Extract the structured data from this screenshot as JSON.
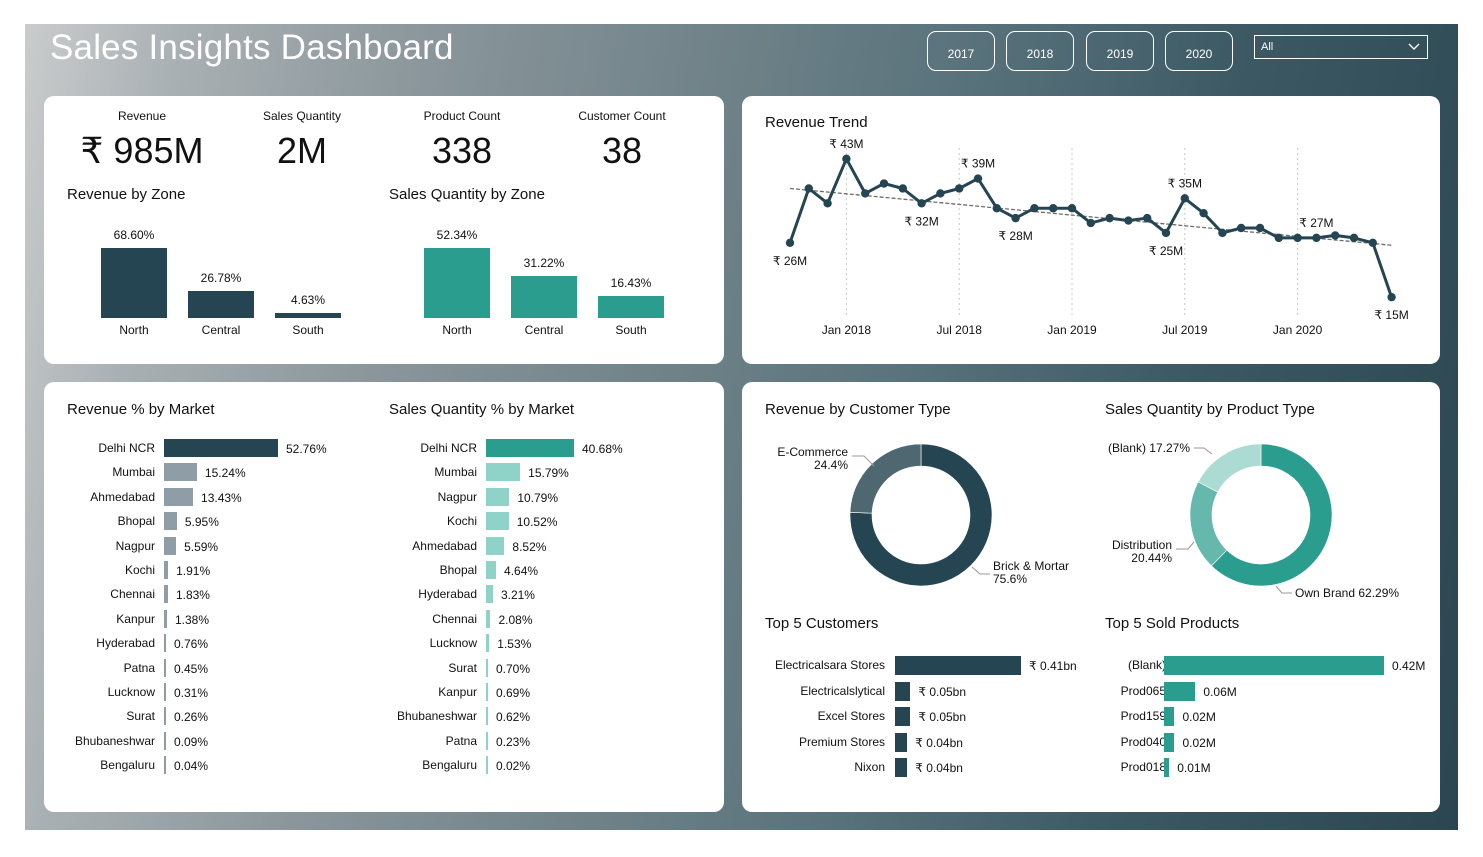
{
  "header": {
    "title": "Sales Insights Dashboard",
    "years": [
      "2017",
      "2018",
      "2019",
      "2020"
    ],
    "dropdown_value": "All"
  },
  "colors": {
    "navy": "#254552",
    "teal": "#2a9d8f",
    "gray_bar": "#8f9ea6",
    "light_teal": "#8fd3c8"
  },
  "kpis": [
    {
      "label": "Revenue",
      "value": "₹ 985M"
    },
    {
      "label": "Sales Quantity",
      "value": "2M"
    },
    {
      "label": "Product Count",
      "value": "338"
    },
    {
      "label": "Customer Count",
      "value": "38"
    }
  ],
  "revenue_by_zone": {
    "title": "Revenue by Zone",
    "items": [
      {
        "zone": "North",
        "pct": 68.6,
        "label": "68.60%"
      },
      {
        "zone": "Central",
        "pct": 26.78,
        "label": "26.78%"
      },
      {
        "zone": "South",
        "pct": 4.63,
        "label": "4.63%"
      }
    ]
  },
  "qty_by_zone": {
    "title": "Sales Quantity by Zone",
    "items": [
      {
        "zone": "North",
        "pct": 52.34,
        "label": "52.34%"
      },
      {
        "zone": "Central",
        "pct": 31.22,
        "label": "31.22%"
      },
      {
        "zone": "South",
        "pct": 16.43,
        "label": "16.43%"
      }
    ]
  },
  "revenue_trend": {
    "title": "Revenue Trend",
    "x_ticks": [
      "Jan 2018",
      "Jul 2018",
      "Jan 2019",
      "Jul 2019",
      "Jan 2020"
    ],
    "labels": [
      {
        "text": "₹ 26M",
        "i": 0,
        "pos": "below"
      },
      {
        "text": "₹ 43M",
        "i": 3,
        "pos": "above"
      },
      {
        "text": "₹ 32M",
        "i": 7,
        "pos": "below"
      },
      {
        "text": "₹ 39M",
        "i": 10,
        "pos": "above"
      },
      {
        "text": "₹ 28M",
        "i": 12,
        "pos": "below"
      },
      {
        "text": "₹ 25M",
        "i": 20,
        "pos": "below"
      },
      {
        "text": "₹ 35M",
        "i": 21,
        "pos": "above"
      },
      {
        "text": "₹ 27M",
        "i": 28,
        "pos": "above"
      },
      {
        "text": "₹ 15M",
        "i": 32,
        "pos": "below"
      }
    ]
  },
  "chart_data": {
    "type": "line",
    "title": "Revenue Trend",
    "x": [
      "Oct 2017",
      "Nov 2017",
      "Dec 2017",
      "Jan 2018",
      "Feb 2018",
      "Mar 2018",
      "Apr 2018",
      "May 2018",
      "Jun 2018",
      "Jul 2018",
      "Aug 2018",
      "Sep 2018",
      "Oct 2018",
      "Nov 2018",
      "Dec 2018",
      "Jan 2019",
      "Feb 2019",
      "Mar 2019",
      "Apr 2019",
      "May 2019",
      "Jun 2019",
      "Jul 2019",
      "Aug 2019",
      "Sep 2019",
      "Oct 2019",
      "Nov 2019",
      "Dec 2019",
      "Jan 2020",
      "Feb 2020",
      "Mar 2020",
      "Apr 2020",
      "May 2020",
      "Jun 2020"
    ],
    "series": [
      {
        "values": [
          26,
          37,
          34,
          43,
          36,
          38,
          37,
          34,
          36,
          37,
          39,
          33,
          31,
          33,
          33,
          33,
          30,
          31,
          30.5,
          31,
          28,
          35,
          32,
          28,
          29,
          29,
          27,
          27,
          27,
          27.5,
          27,
          26,
          15
        ]
      }
    ],
    "trendline": [
      37,
      25.5
    ],
    "ylim": [
      12,
      46
    ]
  },
  "revenue_by_market": {
    "title": "Revenue % by Market",
    "items": [
      {
        "name": "Delhi NCR",
        "pct": 52.76,
        "label": "52.76%"
      },
      {
        "name": "Mumbai",
        "pct": 15.24,
        "label": "15.24%"
      },
      {
        "name": "Ahmedabad",
        "pct": 13.43,
        "label": "13.43%"
      },
      {
        "name": "Bhopal",
        "pct": 5.95,
        "label": "5.95%"
      },
      {
        "name": "Nagpur",
        "pct": 5.59,
        "label": "5.59%"
      },
      {
        "name": "Kochi",
        "pct": 1.91,
        "label": "1.91%"
      },
      {
        "name": "Chennai",
        "pct": 1.83,
        "label": "1.83%"
      },
      {
        "name": "Kanpur",
        "pct": 1.38,
        "label": "1.38%"
      },
      {
        "name": "Hyderabad",
        "pct": 0.76,
        "label": "0.76%"
      },
      {
        "name": "Patna",
        "pct": 0.45,
        "label": "0.45%"
      },
      {
        "name": "Lucknow",
        "pct": 0.31,
        "label": "0.31%"
      },
      {
        "name": "Surat",
        "pct": 0.26,
        "label": "0.26%"
      },
      {
        "name": "Bhubaneshwar",
        "pct": 0.09,
        "label": "0.09%"
      },
      {
        "name": "Bengaluru",
        "pct": 0.04,
        "label": "0.04%"
      }
    ]
  },
  "qty_by_market": {
    "title": "Sales Quantity % by Market",
    "items": [
      {
        "name": "Delhi NCR",
        "pct": 40.68,
        "label": "40.68%"
      },
      {
        "name": "Mumbai",
        "pct": 15.79,
        "label": "15.79%"
      },
      {
        "name": "Nagpur",
        "pct": 10.79,
        "label": "10.79%"
      },
      {
        "name": "Kochi",
        "pct": 10.52,
        "label": "10.52%"
      },
      {
        "name": "Ahmedabad",
        "pct": 8.52,
        "label": "8.52%"
      },
      {
        "name": "Bhopal",
        "pct": 4.64,
        "label": "4.64%"
      },
      {
        "name": "Hyderabad",
        "pct": 3.21,
        "label": "3.21%"
      },
      {
        "name": "Chennai",
        "pct": 2.08,
        "label": "2.08%"
      },
      {
        "name": "Lucknow",
        "pct": 1.53,
        "label": "1.53%"
      },
      {
        "name": "Surat",
        "pct": 0.7,
        "label": "0.70%"
      },
      {
        "name": "Kanpur",
        "pct": 0.69,
        "label": "0.69%"
      },
      {
        "name": "Bhubaneshwar",
        "pct": 0.62,
        "label": "0.62%"
      },
      {
        "name": "Patna",
        "pct": 0.23,
        "label": "0.23%"
      },
      {
        "name": "Bengaluru",
        "pct": 0.02,
        "label": "0.02%"
      }
    ]
  },
  "customer_type": {
    "title": "Revenue by Customer Type",
    "slices": [
      {
        "name": "E-Commerce",
        "pct": 24.4,
        "label1": "E-Commerce",
        "label2": "24.4%",
        "color": "#4f6770"
      },
      {
        "name": "Brick & Mortar",
        "pct": 75.6,
        "label1": "Brick & Mortar",
        "label2": "75.6%",
        "color": "#254552"
      }
    ]
  },
  "product_type": {
    "title": "Sales Quantity by Product Type",
    "slices": [
      {
        "name": "Own Brand",
        "pct": 62.29,
        "label": "Own Brand 62.29%",
        "color": "#2a9d8f"
      },
      {
        "name": "Distribution",
        "pct": 20.44,
        "label1": "Distribution",
        "label2": "20.44%",
        "color": "#66b8ad"
      },
      {
        "name": "(Blank)",
        "pct": 17.27,
        "label": "(Blank) 17.27%",
        "color": "#acdbd3"
      }
    ]
  },
  "top_customers": {
    "title": "Top 5 Customers",
    "items": [
      {
        "name": "Electricalsara Stores",
        "value": 0.41,
        "label": "₹ 0.41bn"
      },
      {
        "name": "Electricalslytical",
        "value": 0.05,
        "label": "₹ 0.05bn"
      },
      {
        "name": "Excel Stores",
        "value": 0.05,
        "label": "₹ 0.05bn"
      },
      {
        "name": "Premium Stores",
        "value": 0.04,
        "label": "₹ 0.04bn"
      },
      {
        "name": "Nixon",
        "value": 0.04,
        "label": "₹ 0.04bn"
      }
    ]
  },
  "top_products": {
    "title": "Top 5 Sold Products",
    "items": [
      {
        "name": "(Blank)",
        "value": 0.42,
        "label": "0.42M"
      },
      {
        "name": "Prod065",
        "value": 0.06,
        "label": "0.06M"
      },
      {
        "name": "Prod159",
        "value": 0.02,
        "label": "0.02M"
      },
      {
        "name": "Prod040",
        "value": 0.02,
        "label": "0.02M"
      },
      {
        "name": "Prod018",
        "value": 0.01,
        "label": "0.01M"
      }
    ]
  }
}
